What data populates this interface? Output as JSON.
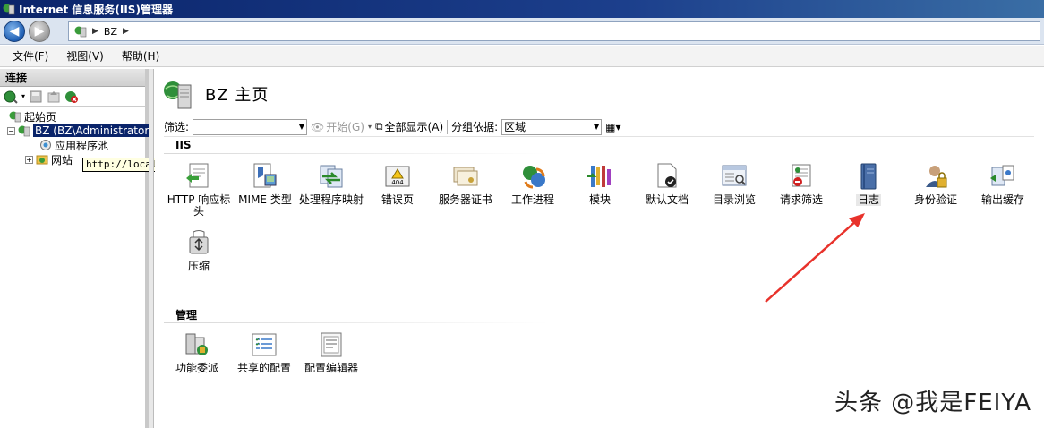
{
  "window": {
    "title": "Internet 信息服务(IIS)管理器"
  },
  "address": {
    "segments": [
      "BZ"
    ]
  },
  "menu": [
    "文件(F)",
    "视图(V)",
    "帮助(H)"
  ],
  "connections": {
    "header": "连接",
    "tree": {
      "start_page": "起始页",
      "server": "BZ (BZ\\Administrator",
      "app_pools": "应用程序池",
      "sites": "网站"
    },
    "tooltip": "http://localhost/"
  },
  "main": {
    "title": "BZ 主页",
    "filter": {
      "label": "筛选:",
      "start": "开始(G)",
      "show_all": "全部显示(A)",
      "group_by_label": "分组依据:",
      "group_by_value": "区域"
    },
    "sections": [
      {
        "name": "IIS"
      },
      {
        "name": "管理"
      }
    ],
    "iis_features": [
      {
        "label": "HTTP 响应标头",
        "icon": "http-headers-icon"
      },
      {
        "label": "MIME 类型",
        "icon": "mime-icon"
      },
      {
        "label": "处理程序映射",
        "icon": "handler-icon"
      },
      {
        "label": "错误页",
        "icon": "error-page-icon",
        "badge": "404"
      },
      {
        "label": "服务器证书",
        "icon": "certificate-icon"
      },
      {
        "label": "工作进程",
        "icon": "worker-process-icon"
      },
      {
        "label": "模块",
        "icon": "modules-icon"
      },
      {
        "label": "默认文档",
        "icon": "default-doc-icon"
      },
      {
        "label": "目录浏览",
        "icon": "directory-browse-icon"
      },
      {
        "label": "请求筛选",
        "icon": "request-filter-icon"
      },
      {
        "label": "日志",
        "icon": "logging-icon"
      },
      {
        "label": "身份验证",
        "icon": "authentication-icon"
      },
      {
        "label": "输出缓存",
        "icon": "output-cache-icon"
      },
      {
        "label": "压缩",
        "icon": "compression-icon"
      }
    ],
    "mgmt_features": [
      {
        "label": "功能委派",
        "icon": "feature-delegation-icon"
      },
      {
        "label": "共享的配置",
        "icon": "shared-config-icon"
      },
      {
        "label": "配置编辑器",
        "icon": "config-editor-icon"
      }
    ]
  },
  "watermark": "头条 @我是FEIYA",
  "colors": {
    "titlebar": "#0a246a",
    "selection": "#0a246a",
    "arrow": "#e8322b"
  }
}
